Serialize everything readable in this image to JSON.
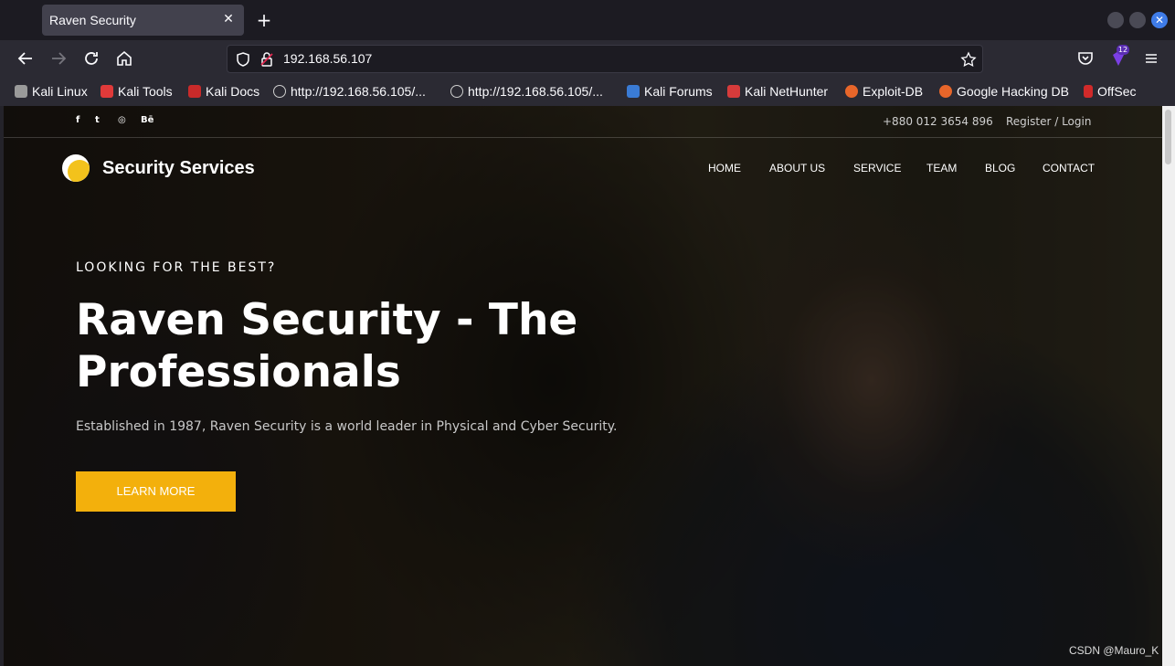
{
  "browser": {
    "tab_title": "Raven Security",
    "tab_close": "✕",
    "new_tab": "+",
    "url": "192.168.56.107",
    "extension_badge": "12",
    "bookmarks": [
      {
        "label": "Kali Linux",
        "icon": "kali-dragon-icon",
        "color": "#cfcfcf"
      },
      {
        "label": "Kali Tools",
        "icon": "kali-tools-icon",
        "color": "#e03a3a"
      },
      {
        "label": "Kali Docs",
        "icon": "kali-docs-icon",
        "color": "#c92a2a"
      },
      {
        "label": "http://192.168.56.105/...",
        "icon": "globe-icon",
        "color": "#cfcfcf"
      },
      {
        "label": "http://192.168.56.105/...",
        "icon": "globe-icon",
        "color": "#cfcfcf"
      },
      {
        "label": "Kali Forums",
        "icon": "kali-forums-icon",
        "color": "#3a7bd5"
      },
      {
        "label": "Kali NetHunter",
        "icon": "nethunter-icon",
        "color": "#d63b3b"
      },
      {
        "label": "Exploit-DB",
        "icon": "exploit-db-icon",
        "color": "#e8662a"
      },
      {
        "label": "Google Hacking DB",
        "icon": "ghdb-icon",
        "color": "#e8662a"
      },
      {
        "label": "OffSec",
        "icon": "offsec-icon",
        "color": "#d12a2a"
      }
    ]
  },
  "site": {
    "social": [
      "f",
      "t",
      "◎",
      "Bē"
    ],
    "phone": "+880 012 3654 896",
    "register_login": "Register / Login",
    "logo_text": "Security Services",
    "menu": [
      "HOME",
      "ABOUT US",
      "SERVICE",
      "TEAM",
      "BLOG",
      "CONTACT"
    ],
    "hero": {
      "kicker": "LOOKING FOR THE BEST?",
      "headline": "Raven Security - The Professionals",
      "subline": "Established in 1987, Raven Security is a world leader in Physical and Cyber Security.",
      "cta": "LEARN MORE"
    },
    "accent": "#f3b00c"
  },
  "watermark": "CSDN @Mauro_K"
}
